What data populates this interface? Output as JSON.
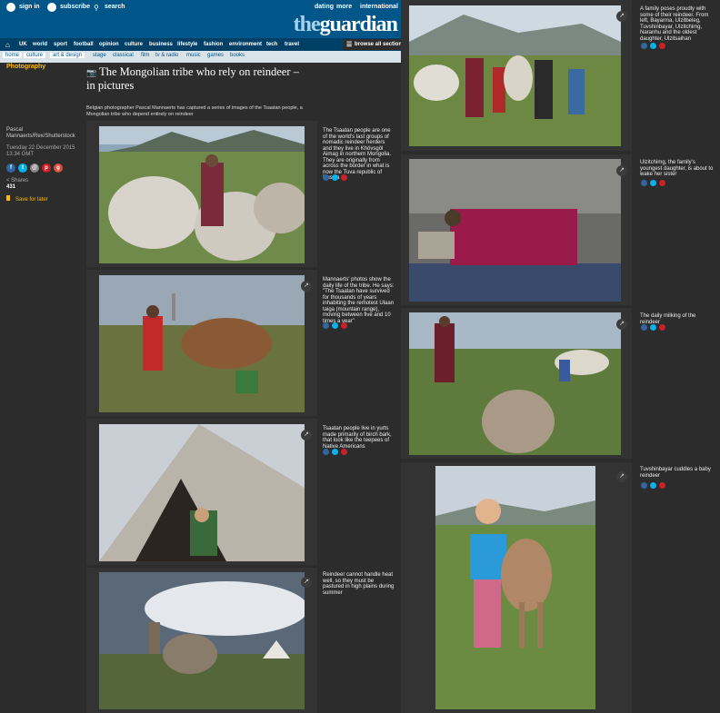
{
  "header": {
    "sign_in": "sign in",
    "subscribe": "subscribe",
    "search": "search",
    "dating": "dating",
    "more": "more",
    "international": "international",
    "logo_the": "the",
    "logo_guardian": "guardian"
  },
  "nav": {
    "items": [
      "UK",
      "world",
      "sport",
      "football",
      "opinion",
      "culture",
      "business",
      "lifestyle",
      "fashion",
      "environment",
      "tech",
      "travel"
    ],
    "browse": "browse all sections"
  },
  "subnav": {
    "crumbs": [
      "home",
      "culture",
      "art & design"
    ],
    "items": [
      "stage",
      "classical",
      "film",
      "tv & radio",
      "music",
      "games",
      "books"
    ]
  },
  "article": {
    "section": "Photography",
    "title": "The Mongolian tribe who rely on reindeer – in pictures",
    "standfirst": "Belgian photographer Pascal Mannaerts has captured a series of images of the Tsaatan people, a Mongolian tribe who depend entirely on reindeer",
    "byline": "Pascal Mannaerts/Rex/Shutterstock",
    "date_line1": "Tuesday 22 December 2015",
    "date_line2": "13.34 GMT",
    "shares_label": "Shares",
    "shares_count": "431",
    "save_label": "Save for later"
  },
  "gallery": {
    "left": [
      {
        "caption": "The Tsaatan people are one of the world's last groups of nomadic reindeer herders and they live in Khövsgöl Aimag in northern Mongolia. They are originally from across the border in what is now the Tuva republic of Russia"
      },
      {
        "caption": "Mannaerts' photos show the daily life of the tribe. He says: \"The Tsaatan have survived for thousands of years inhabiting the remotest Ulaan taiga (mountain range), moving between five and 10 times a year\""
      },
      {
        "caption": "Tsaatan people live in yurts made primarily of birch bark, that look like the teepees of Native Americans"
      },
      {
        "caption": "Reindeer cannot handle heat well, so they must be pastured in high plains during summer"
      }
    ],
    "right": [
      {
        "caption": "A family poses proudly with some of their reindeer. From left, Bayarma, Ulzitbeleg, Tuvshinbayar, Ulzitchimg, Naranhu and the oldest daughter, Ulzitsaihan"
      },
      {
        "caption": "Ulzitchimg, the family's youngest daughter, is about to wake her sister"
      },
      {
        "caption": "The daily milking of the reindeer"
      },
      {
        "caption": "Tuvshinbayar cuddles a baby reindeer"
      }
    ]
  },
  "icons": {
    "expand": "expand-icon",
    "facebook": "f",
    "twitter": "t",
    "pinterest": "p"
  },
  "colors": {
    "brand_blue": "#005689",
    "accent_yellow": "#ffbb00",
    "facebook": "#3067a3",
    "twitter": "#03b3ee",
    "pinterest": "#cb2027"
  }
}
